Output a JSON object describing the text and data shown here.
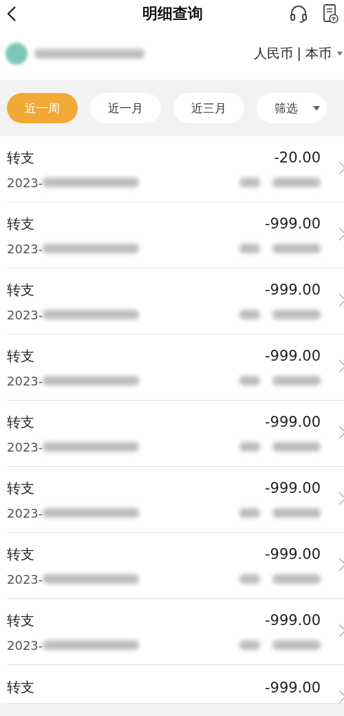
{
  "header": {
    "title": "明细查询"
  },
  "account": {
    "currency": "人民币 | 本币"
  },
  "filters": [
    {
      "label": "近一周",
      "selected": true,
      "kind": "chip"
    },
    {
      "label": "近一月",
      "selected": false,
      "kind": "chip"
    },
    {
      "label": "近三月",
      "selected": false,
      "kind": "chip"
    },
    {
      "label": "筛选",
      "selected": false,
      "kind": "dropdown"
    }
  ],
  "transactions": [
    {
      "title": "转支",
      "amount": "-20.00",
      "date": "2023-"
    },
    {
      "title": "转支",
      "amount": "-999.00",
      "date": "2023-"
    },
    {
      "title": "转支",
      "amount": "-999.00",
      "date": "2023-"
    },
    {
      "title": "转支",
      "amount": "-999.00",
      "date": "2023-"
    },
    {
      "title": "转支",
      "amount": "-999.00",
      "date": "2023-"
    },
    {
      "title": "转支",
      "amount": "-999.00",
      "date": "2023-"
    },
    {
      "title": "转支",
      "amount": "-999.00",
      "date": "2023-"
    },
    {
      "title": "转支",
      "amount": "-999.00",
      "date": "2023-"
    },
    {
      "title": "转支",
      "amount": "-999.00"
    }
  ]
}
